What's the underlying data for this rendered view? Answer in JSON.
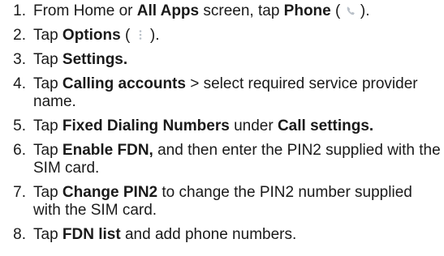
{
  "steps": [
    {
      "num": "1.",
      "parts": [
        {
          "t": "From Home or ",
          "b": false
        },
        {
          "t": "All Apps",
          "b": true
        },
        {
          "t": " screen, tap ",
          "b": false
        },
        {
          "t": "Phone",
          "b": true
        },
        {
          "t": " ( ",
          "b": false
        },
        {
          "icon": "phone-icon"
        },
        {
          "t": " ).",
          "b": false
        }
      ]
    },
    {
      "num": "2.",
      "parts": [
        {
          "t": "Tap ",
          "b": false
        },
        {
          "t": "Options",
          "b": true
        },
        {
          "t": " ( ",
          "b": false
        },
        {
          "icon": "more-options-icon"
        },
        {
          "t": " ).",
          "b": false
        }
      ]
    },
    {
      "num": "3.",
      "parts": [
        {
          "t": "Tap ",
          "b": false
        },
        {
          "t": "Settings.",
          "b": true
        }
      ]
    },
    {
      "num": "4.",
      "parts": [
        {
          "t": "Tap ",
          "b": false
        },
        {
          "t": "Calling accounts",
          "b": true
        },
        {
          "t": " > select required service provider name.",
          "b": false
        }
      ]
    },
    {
      "num": "5.",
      "parts": [
        {
          "t": "Tap ",
          "b": false
        },
        {
          "t": "Fixed Dialing Numbers",
          "b": true
        },
        {
          "t": " under ",
          "b": false
        },
        {
          "t": "Call settings.",
          "b": true
        }
      ]
    },
    {
      "num": "6.",
      "parts": [
        {
          "t": "Tap ",
          "b": false
        },
        {
          "t": "Enable FDN,",
          "b": true
        },
        {
          "t": " and then enter the PIN2 supplied with the SIM card.",
          "b": false
        }
      ]
    },
    {
      "num": "7.",
      "parts": [
        {
          "t": "Tap ",
          "b": false
        },
        {
          "t": "Change PIN2",
          "b": true
        },
        {
          "t": " to change the PIN2 number supplied with the SIM card.",
          "b": false
        }
      ]
    },
    {
      "num": "8.",
      "parts": [
        {
          "t": "Tap ",
          "b": false
        },
        {
          "t": "FDN list",
          "b": true
        },
        {
          "t": " and add phone numbers.",
          "b": false
        }
      ]
    }
  ],
  "icon_color": "#b9c0c8"
}
